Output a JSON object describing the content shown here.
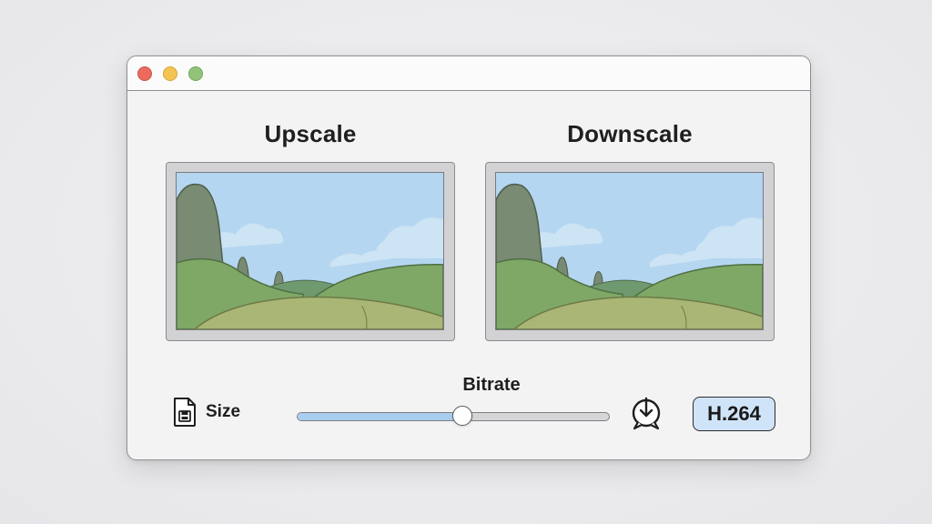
{
  "panels": {
    "left_title": "Upscale",
    "right_title": "Downscale"
  },
  "controls": {
    "size_label": "Size",
    "bitrate_label": "Bitrate",
    "bitrate_level": 0.53,
    "codec": "H.264"
  },
  "icons": {
    "window_close": "close-dot-icon",
    "window_minimize": "minimize-dot-icon",
    "window_maximize": "maximize-dot-icon",
    "size": "file-size-icon",
    "export": "download-icon"
  },
  "colors": {
    "close": "#ec6a5e",
    "minimize": "#f4c453",
    "maximize": "#92c379",
    "slider_fill": "#a9cdee",
    "badge_bg": "#cfe4f8",
    "sky": "#b5d6f0",
    "hill": "#7fa866",
    "foreground": "#a9b676"
  }
}
